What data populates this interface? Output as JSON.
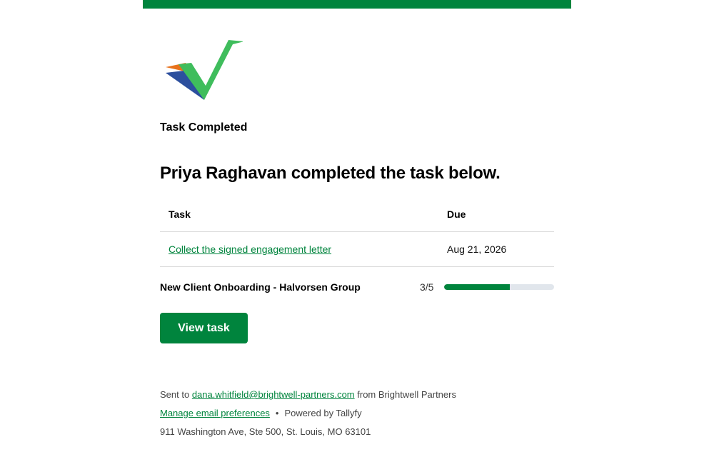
{
  "brand": {
    "accent": "#00843d",
    "logo": "checkmark-logo"
  },
  "email": {
    "subtitle": "Task Completed",
    "headline": "Priya Raghavan completed the task below.",
    "table": {
      "headers": {
        "task": "Task",
        "due": "Due"
      },
      "row": {
        "task": "Collect the signed engagement letter",
        "due": "Aug 21, 2026"
      }
    },
    "process": {
      "name": "New Client Onboarding - Halvorsen Group",
      "progress_label": "3/5",
      "completed": 3,
      "total": 5
    },
    "button_label": "View task"
  },
  "footer": {
    "sent_to_prefix": "Sent to",
    "recipient": "dana.whitfield@brightwell-partners.com",
    "from_text": "from Brightwell Partners",
    "manage_prefs": "Manage email preferences",
    "separator": "•",
    "powered_by": "Powered by Tallyfy",
    "address": "911 Washington Ave, Ste 500, St. Louis, MO 63101"
  }
}
